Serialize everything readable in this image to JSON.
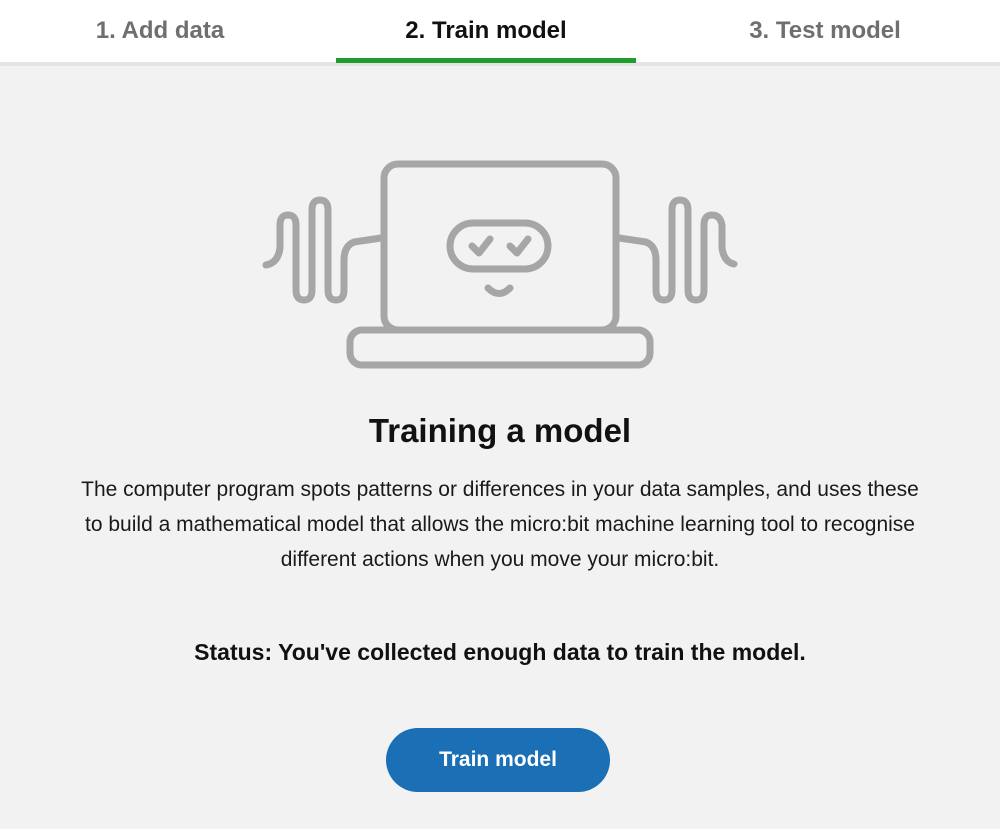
{
  "tabs": [
    {
      "label": "1. Add data"
    },
    {
      "label": "2. Train model"
    },
    {
      "label": "3. Test model"
    }
  ],
  "active_tab_index": 1,
  "colors": {
    "active_underline": "#1f9c2c",
    "button": "#1a6fb5",
    "illustration_stroke": "#a6a6a6"
  },
  "illustration": {
    "icon": "laptop-robot-sound-waves-icon"
  },
  "content": {
    "title": "Training a model",
    "description": "The computer program spots patterns or differences in your data samples, and uses these to build a mathematical model that allows the micro:bit machine learning tool to recognise different actions when you move your micro:bit.",
    "status": "Status: You've collected enough data to train the model.",
    "button_label": "Train model"
  }
}
